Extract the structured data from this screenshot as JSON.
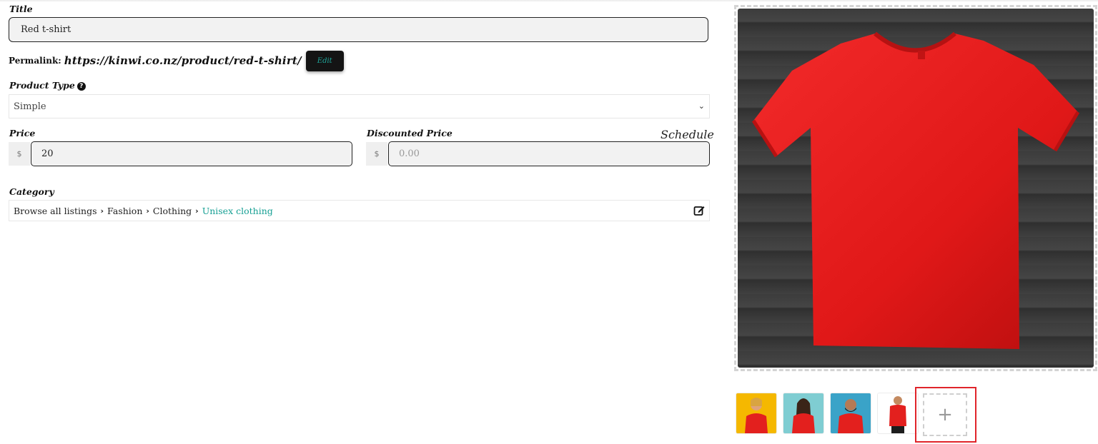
{
  "form": {
    "title_label": "Title",
    "title_value": "Red t-shirt",
    "permalink_label": "Permalink:",
    "permalink_url": "https://kinwi.co.nz/product/red-t-shirt/",
    "edit_label": "Edit",
    "product_type_label": "Product Type",
    "product_type_value": "Simple",
    "price_label": "Price",
    "currency_symbol": "$",
    "price_value": "20",
    "discounted_price_label": "Discounted Price",
    "discounted_price_placeholder": "0.00",
    "schedule_label": "Schedule",
    "category_label": "Category",
    "category_path": [
      "Browse all listings",
      "Fashion",
      "Clothing",
      "Unisex clothing"
    ]
  },
  "gallery": {
    "add_label": "+"
  },
  "colors": {
    "accent": "#17a094",
    "highlight": "#e0242a",
    "shirt": "#e51d1d"
  },
  "icons": {
    "help": "question-circle-icon",
    "chevron": "chevron-down-icon",
    "edit": "edit-square-icon"
  }
}
